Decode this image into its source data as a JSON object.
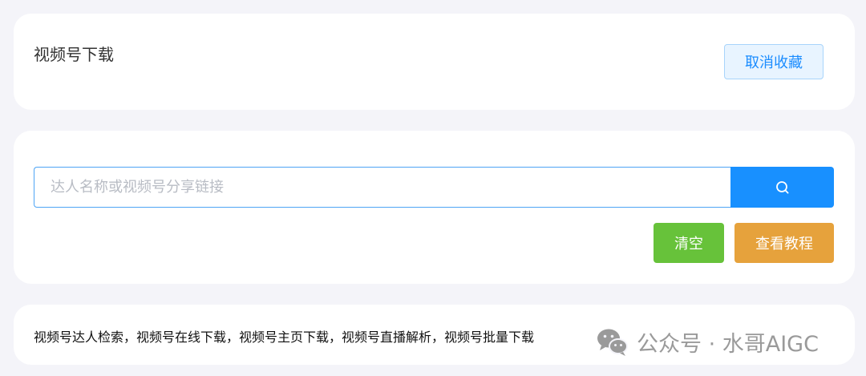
{
  "header": {
    "title": "视频号下载",
    "unfavorite_label": "取消收藏"
  },
  "search": {
    "placeholder": "达人名称或视频号分享链接",
    "value": "",
    "icon": "search-icon"
  },
  "actions": {
    "clear_label": "清空",
    "tutorial_label": "查看教程"
  },
  "description": {
    "text": "视频号达人检索，视频号在线下载，视频号主页下载，视频号直播解析，视频号批量下载"
  },
  "watermark": {
    "text": "公众号 · 水哥AIGC",
    "icon": "wechat-icon"
  },
  "colors": {
    "primary": "#1890ff",
    "success": "#67c23a",
    "warning": "#e6a23c",
    "background": "#f4f4f9"
  }
}
